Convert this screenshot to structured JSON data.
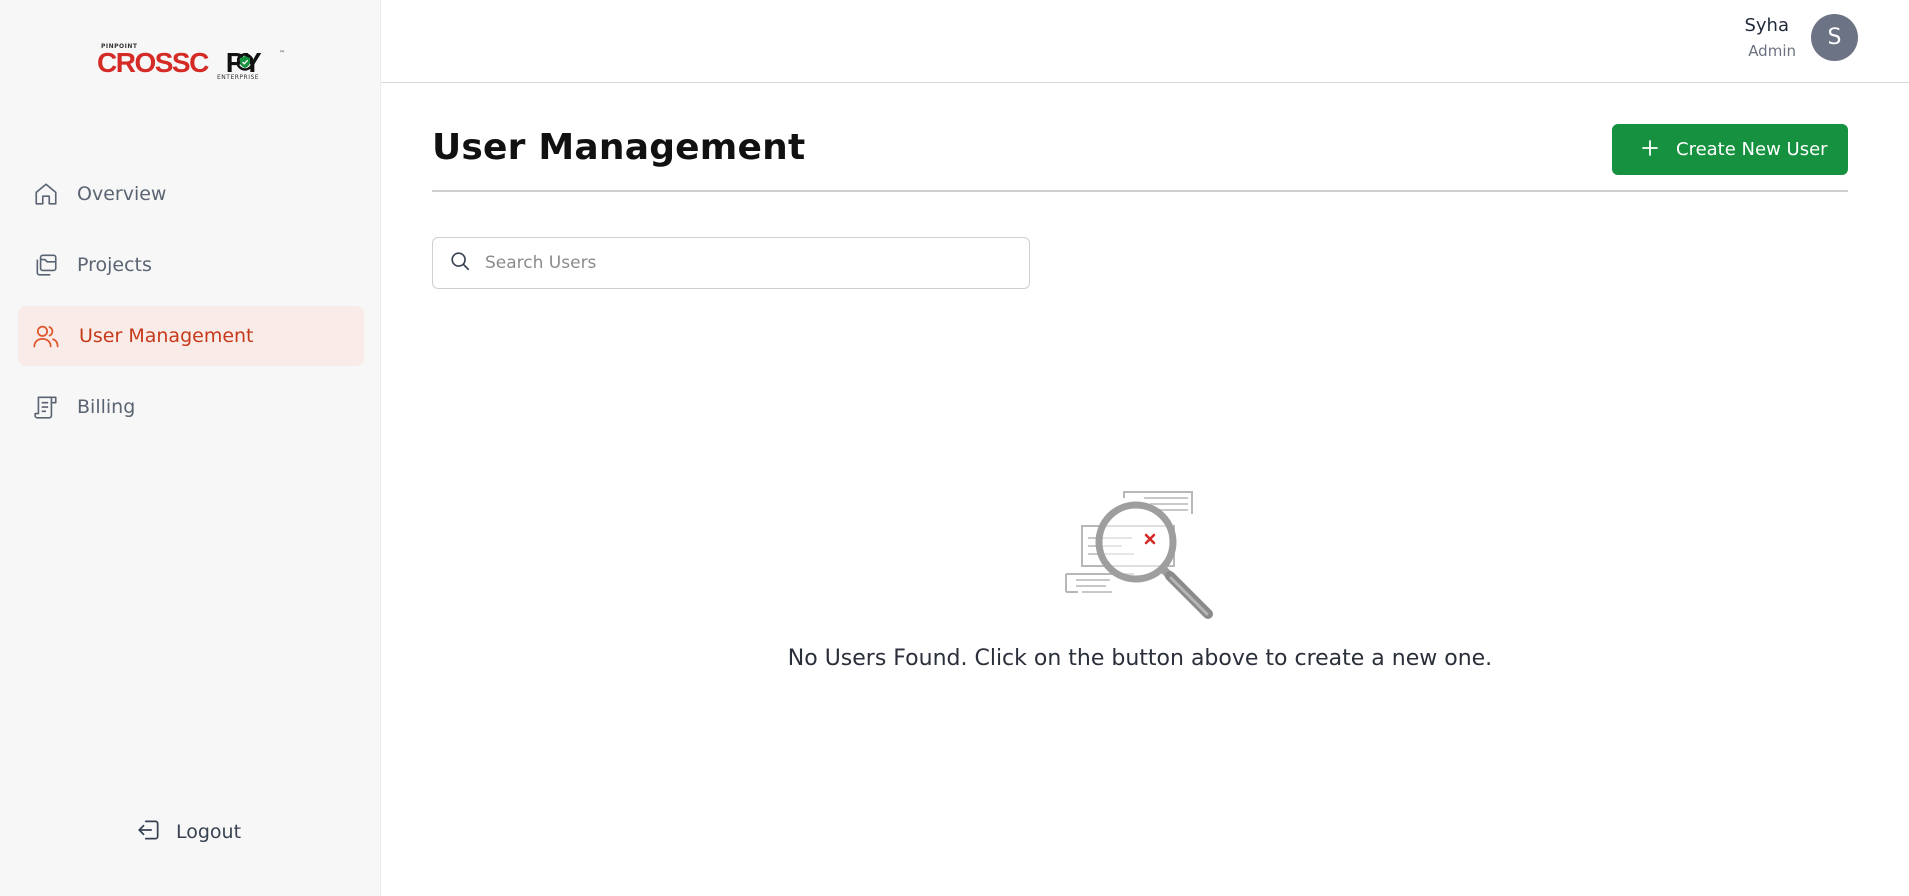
{
  "brand": {
    "small_top": "PINPOINT",
    "word_part1": "CROSSC",
    "word_part2": "PY",
    "small_bottom": "ENTERPRISE",
    "trademark": "™",
    "accent_color": "#d42b27"
  },
  "sidebar": {
    "items": [
      {
        "label": "Overview",
        "icon": "home-icon",
        "active": false
      },
      {
        "label": "Projects",
        "icon": "folders-icon",
        "active": false
      },
      {
        "label": "User Management",
        "icon": "users-icon",
        "active": true
      },
      {
        "label": "Billing",
        "icon": "receipt-icon",
        "active": false
      }
    ],
    "logout_label": "Logout"
  },
  "header": {
    "user_name": "Syha",
    "user_role": "Admin",
    "avatar_initial": "S"
  },
  "main": {
    "title": "User Management",
    "create_button_label": "Create New User",
    "search_placeholder": "Search Users",
    "empty_message": "No Users Found. Click on the button above to create a new one."
  },
  "colors": {
    "primary_green": "#15913f",
    "active_nav_bg": "#f9ebe7",
    "active_nav_text": "#c7391b",
    "avatar_bg": "#6b7385"
  }
}
